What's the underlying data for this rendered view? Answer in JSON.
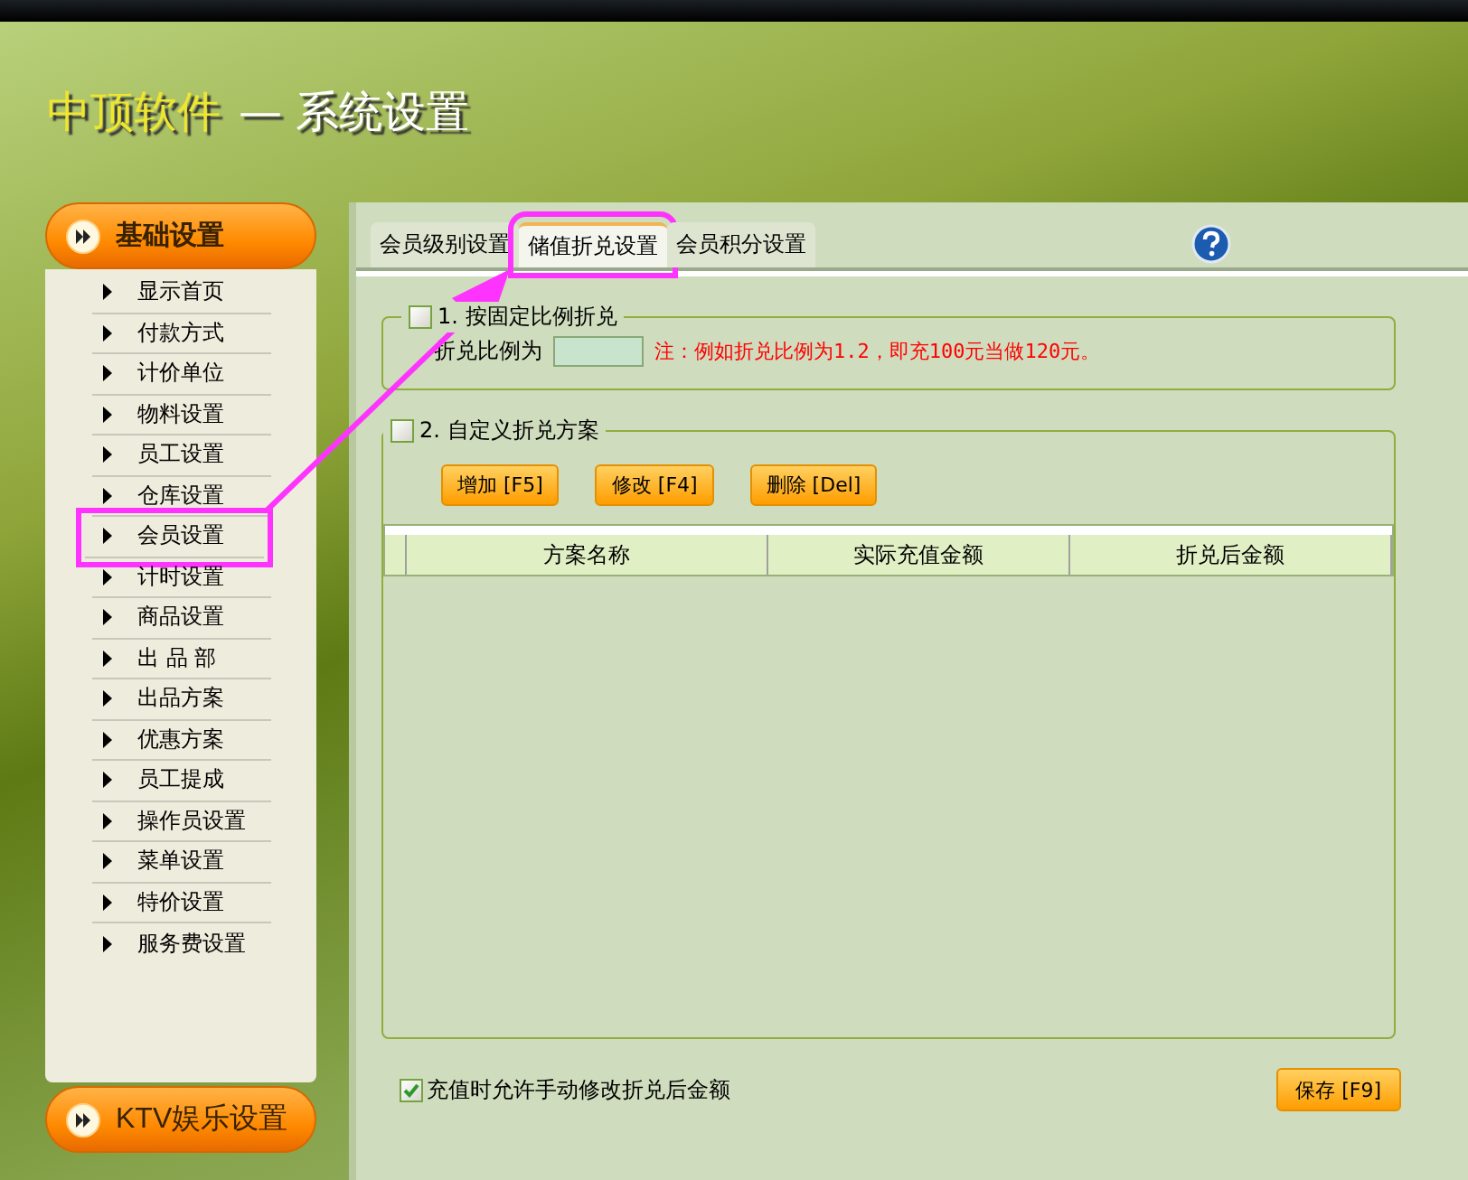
{
  "header": {
    "brand": "中顶软件",
    "title": "— 系统设置"
  },
  "sidebar": {
    "header": "基础设置",
    "items": [
      {
        "label": "显示首页",
        "selected": false
      },
      {
        "label": "付款方式",
        "selected": false
      },
      {
        "label": "计价单位",
        "selected": false
      },
      {
        "label": "物料设置",
        "selected": false
      },
      {
        "label": "员工设置",
        "selected": false
      },
      {
        "label": "仓库设置",
        "selected": false
      },
      {
        "label": "会员设置",
        "selected": true
      },
      {
        "label": "计时设置",
        "selected": false
      },
      {
        "label": "商品设置",
        "selected": false
      },
      {
        "label": "出 品 部",
        "selected": false
      },
      {
        "label": "出品方案",
        "selected": false
      },
      {
        "label": "优惠方案",
        "selected": false
      },
      {
        "label": "员工提成",
        "selected": false
      },
      {
        "label": "操作员设置",
        "selected": false
      },
      {
        "label": "菜单设置",
        "selected": false
      },
      {
        "label": "特价设置",
        "selected": false
      },
      {
        "label": "服务费设置",
        "selected": false
      }
    ],
    "footer": "KTV娱乐设置"
  },
  "tabs": [
    {
      "label": "会员级别设置",
      "selected": false
    },
    {
      "label": "储值折兑设置",
      "selected": true
    },
    {
      "label": "会员积分设置",
      "selected": false
    }
  ],
  "group_fixed": {
    "label": "1. 按固定比例折兑",
    "checked": false,
    "field_label": "折兑比例为",
    "note": "注：例如折兑比例为1.2，即充100元当做120元。"
  },
  "group_custom": {
    "label": "2. 自定义折兑方案",
    "checked": false,
    "buttons": [
      "增加 [F5]",
      "修改 [F4]",
      "删除 [Del]"
    ],
    "table": {
      "columns": [
        "方案名称",
        "实际充值金额",
        "折兑后金额"
      ]
    }
  },
  "allow_manual": {
    "label": "充值时允许手动修改折兑后金额",
    "checked": true
  },
  "save_button": "保存 [F9]"
}
